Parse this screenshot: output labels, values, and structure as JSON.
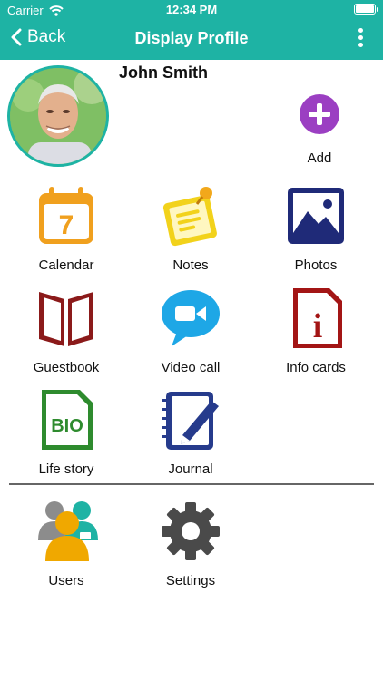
{
  "status_bar": {
    "carrier": "Carrier",
    "time": "12:34 PM"
  },
  "nav": {
    "back_label": "Back",
    "title": "Display Profile"
  },
  "profile": {
    "name": "John Smith"
  },
  "add": {
    "label": "Add"
  },
  "grid": [
    {
      "label": "Calendar",
      "icon": "calendar-icon",
      "day": "7"
    },
    {
      "label": "Notes",
      "icon": "notes-icon"
    },
    {
      "label": "Photos",
      "icon": "photos-icon"
    },
    {
      "label": "Guestbook",
      "icon": "guestbook-icon"
    },
    {
      "label": "Video call",
      "icon": "video-call-icon"
    },
    {
      "label": "Info cards",
      "icon": "info-cards-icon",
      "glyph": "i"
    },
    {
      "label": "Life story",
      "icon": "life-story-icon",
      "glyph": "BIO"
    },
    {
      "label": "Journal",
      "icon": "journal-icon"
    }
  ],
  "bottom": [
    {
      "label": "Users",
      "icon": "users-icon"
    },
    {
      "label": "Settings",
      "icon": "settings-icon"
    }
  ],
  "colors": {
    "header": "#1eb3a4",
    "add": "#9b3fc2",
    "calendar": "#f0a01e",
    "notes": "#f2d21b",
    "photos": "#1f2a78",
    "guestbook": "#8b1a1a",
    "video": "#1ea7e6",
    "info": "#a31515",
    "bio": "#2e8b2e",
    "journal": "#263b8c"
  }
}
